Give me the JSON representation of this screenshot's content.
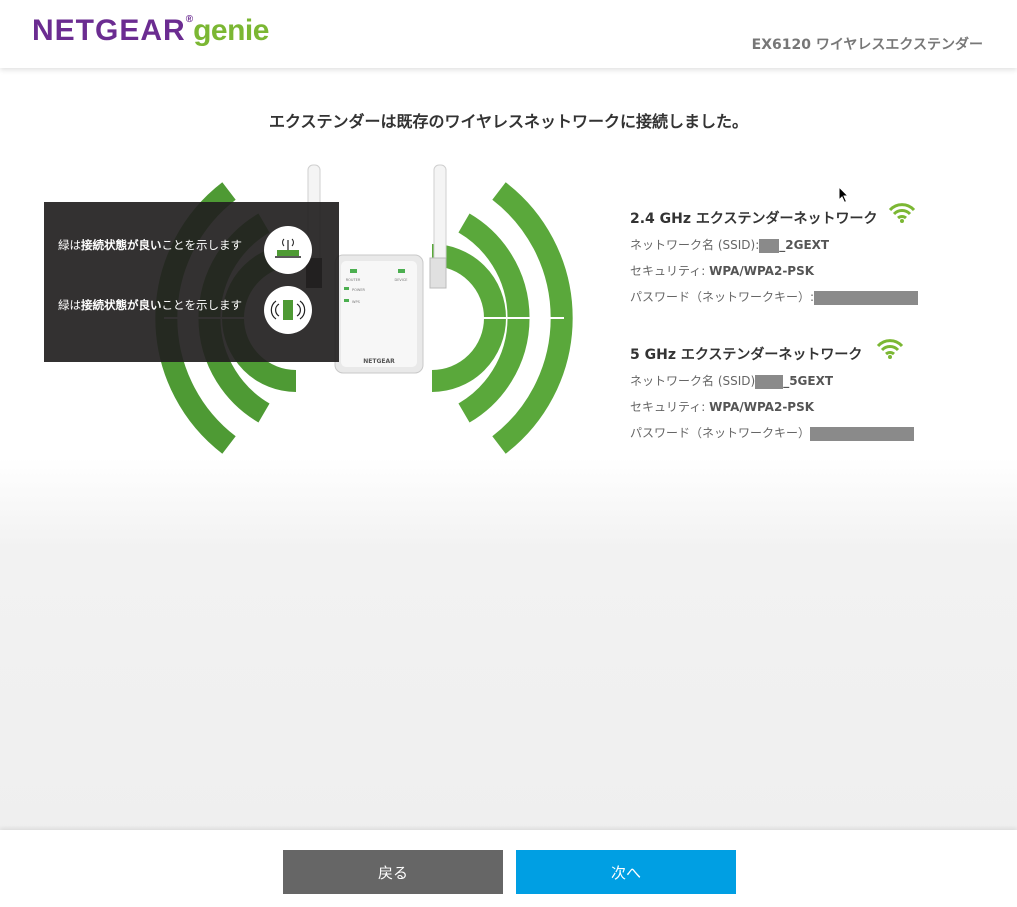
{
  "header": {
    "logo_brand": "NETGEAR",
    "logo_reg": "®",
    "logo_product": "genie",
    "model_title": "EX6120 ワイヤレスエクステンダー"
  },
  "main": {
    "title": "エクステンダーは既存のワイヤレスネットワークに接続しました。",
    "legend": [
      {
        "text_plain_1": "緑は",
        "text_bold": "接続状態が良い",
        "text_plain_2": "ことを示します",
        "icon": "router-icon"
      },
      {
        "text_plain_1": "緑は",
        "text_bold": "接続状態が良い",
        "text_plain_2": "ことを示します",
        "icon": "device-signal-icon"
      }
    ],
    "device": {
      "brand": "NETGEAR",
      "led_router": "ROUTER",
      "led_device": "DEVICE",
      "led_power": "POWER",
      "led_wps": "WPS"
    },
    "networks": [
      {
        "title": "2.4 GHz エクステンダーネットワーク",
        "ssid_label": "ネットワーク名 (SSID):",
        "ssid_value": "_2GEXT",
        "security_label": "セキュリティ:",
        "security_value": "WPA/WPA2-PSK",
        "password_label": "パスワード（ネットワークキー）:"
      },
      {
        "title": "5 GHz エクステンダーネットワーク",
        "ssid_label": "ネットワーク名 (SSID)",
        "ssid_value": "_5GEXT",
        "security_label": "セキュリティ:",
        "security_value": "WPA/WPA2-PSK",
        "password_label": "パスワード（ネットワークキー）"
      }
    ]
  },
  "footer": {
    "back_label": "戻る",
    "next_label": "次へ"
  },
  "colors": {
    "brand_purple": "#6b2c91",
    "brand_green": "#7bb733",
    "signal_green": "#4e9a34",
    "next_blue": "#009fe3",
    "back_gray": "#666666"
  }
}
